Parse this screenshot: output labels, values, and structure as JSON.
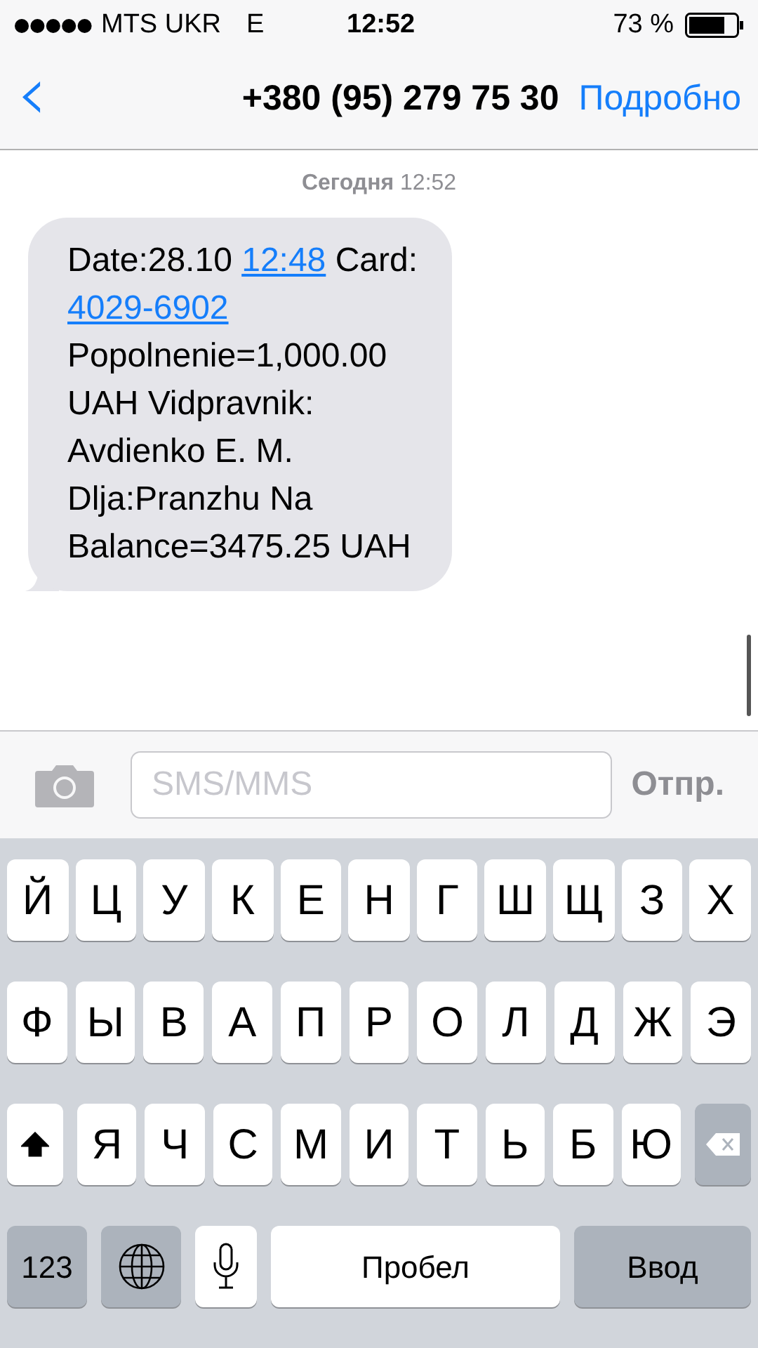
{
  "status_bar": {
    "carrier": "MTS UKR",
    "network": "E",
    "time": "12:52",
    "battery": "73 %"
  },
  "nav": {
    "back": "‹",
    "title": "+380 (95) 279 75 30",
    "details": "Подробно"
  },
  "timestamp": {
    "day": "Сегодня",
    "time": "12:52"
  },
  "message": {
    "lines": [
      [
        {
          "kind": "text",
          "text": "Date:28.10 "
        },
        {
          "kind": "link",
          "text": "12:48"
        },
        {
          "kind": "text",
          "text": " Card:"
        }
      ],
      [
        {
          "kind": "link",
          "text": "4029-6902"
        }
      ],
      [
        {
          "kind": "text",
          "text": "Popolnenie=1,000.00"
        }
      ],
      [
        {
          "kind": "text",
          "text": "UAH Vidpravnik:"
        }
      ],
      [
        {
          "kind": "text",
          "text": "Avdienko E. M."
        }
      ],
      [
        {
          "kind": "text",
          "text": "Dlja:Pranzhu Na"
        }
      ],
      [
        {
          "kind": "text",
          "text": "Balance=3475.25 UAH"
        }
      ]
    ]
  },
  "composer": {
    "placeholder": "SMS/MMS",
    "send": "Отпр.",
    "send_disabled": true
  },
  "keyboard": {
    "rows": [
      [
        {
          "kind": "letter",
          "label": "Й"
        },
        {
          "kind": "letter",
          "label": "Ц"
        },
        {
          "kind": "letter",
          "label": "У"
        },
        {
          "kind": "letter",
          "label": "К"
        },
        {
          "kind": "letter",
          "label": "Е"
        },
        {
          "kind": "letter",
          "label": "Н"
        },
        {
          "kind": "letter",
          "label": "Г"
        },
        {
          "kind": "letter",
          "label": "Ш"
        },
        {
          "kind": "letter",
          "label": "Щ"
        },
        {
          "kind": "letter",
          "label": "З"
        },
        {
          "kind": "letter",
          "label": "Х"
        }
      ],
      [
        {
          "kind": "letter",
          "label": "Ф"
        },
        {
          "kind": "letter",
          "label": "Ы"
        },
        {
          "kind": "letter",
          "label": "В"
        },
        {
          "kind": "letter",
          "label": "А"
        },
        {
          "kind": "letter",
          "label": "П"
        },
        {
          "kind": "letter",
          "label": "Р"
        },
        {
          "kind": "letter",
          "label": "О"
        },
        {
          "kind": "letter",
          "label": "Л"
        },
        {
          "kind": "letter",
          "label": "Д"
        },
        {
          "kind": "letter",
          "label": "Ж"
        },
        {
          "kind": "letter",
          "label": "Э"
        }
      ],
      [
        {
          "kind": "shift",
          "on": true
        },
        {
          "kind": "letter",
          "label": "Я"
        },
        {
          "kind": "letter",
          "label": "Ч"
        },
        {
          "kind": "letter",
          "label": "С"
        },
        {
          "kind": "letter",
          "label": "М"
        },
        {
          "kind": "letter",
          "label": "И"
        },
        {
          "kind": "letter",
          "label": "Т"
        },
        {
          "kind": "letter",
          "label": "Ь"
        },
        {
          "kind": "letter",
          "label": "Б"
        },
        {
          "kind": "letter",
          "label": "Ю"
        },
        {
          "kind": "backspace"
        }
      ]
    ],
    "function_row": [
      {
        "kind": "numbers",
        "label": "123"
      },
      {
        "kind": "globe"
      },
      {
        "kind": "mic"
      },
      {
        "kind": "space",
        "label": "Пробел"
      },
      {
        "kind": "return",
        "label": "Ввод"
      }
    ]
  }
}
